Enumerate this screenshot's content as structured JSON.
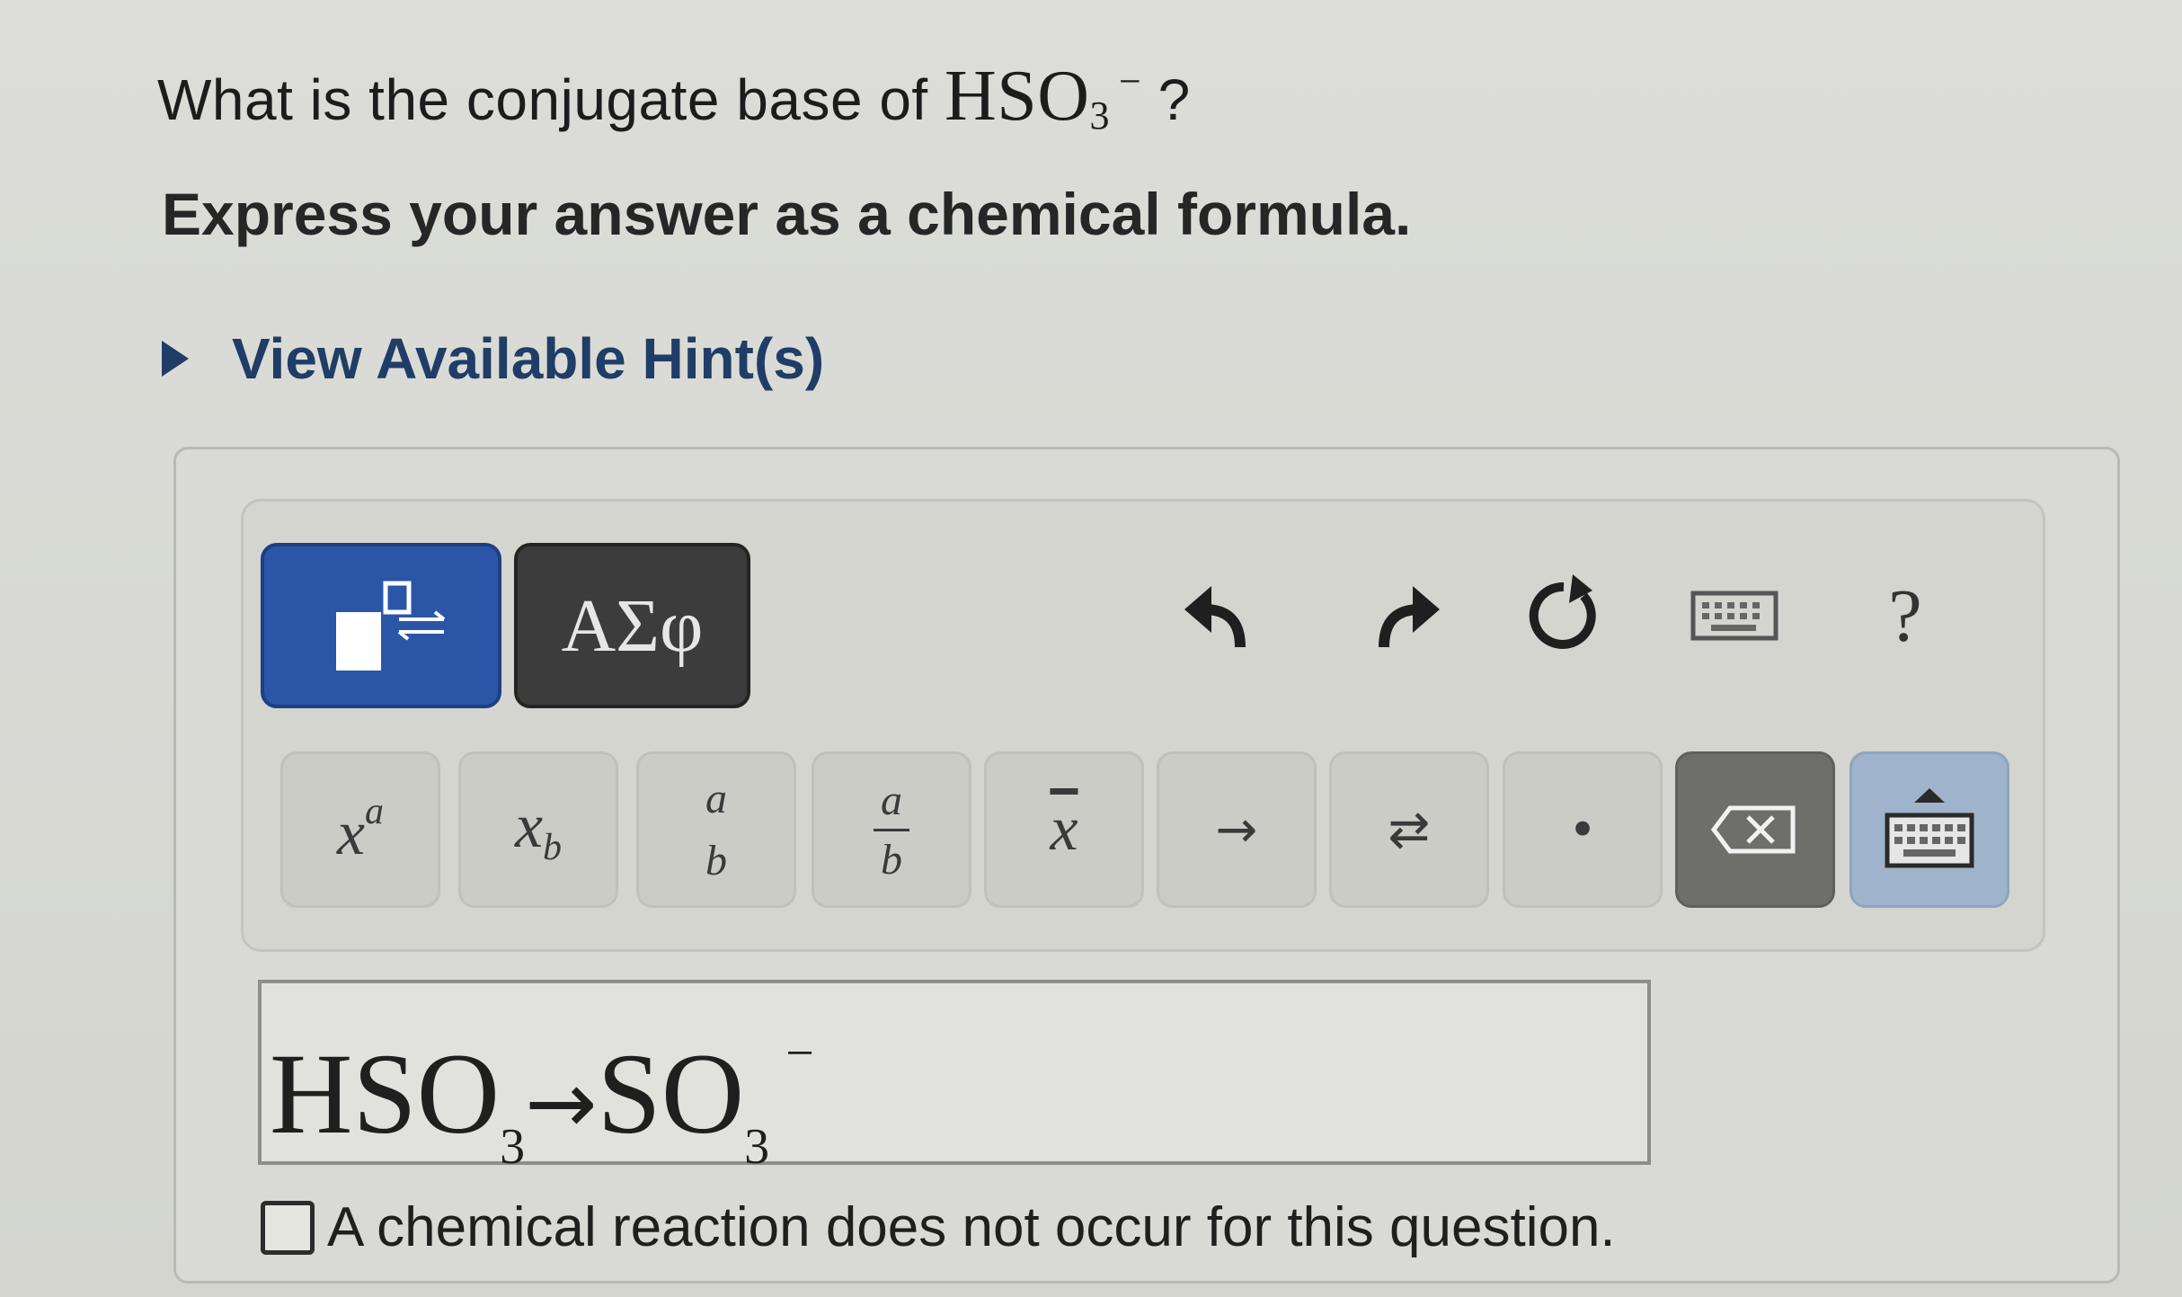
{
  "question": {
    "prefix": "What is the conjugate base of",
    "formula_main": "HSO",
    "formula_sub": "3",
    "formula_charge": "−",
    "suffix": "?"
  },
  "instruction": "Express your answer as a chemical formula.",
  "hint": {
    "label": "View Available Hint(s)",
    "icon": "triangle-right-icon"
  },
  "toolbar": {
    "modes": [
      {
        "name": "templates",
        "icon": "templates-icon",
        "active": true
      },
      {
        "name": "greek",
        "label": "ΑΣφ",
        "active": false
      }
    ],
    "tools": [
      {
        "name": "undo",
        "icon": "undo-icon"
      },
      {
        "name": "redo",
        "icon": "redo-icon"
      },
      {
        "name": "reset",
        "icon": "reset-icon"
      },
      {
        "name": "keyboard",
        "icon": "keyboard-icon"
      },
      {
        "name": "help",
        "label": "?"
      }
    ],
    "keys": [
      {
        "name": "superscript",
        "base": "x",
        "script": "a"
      },
      {
        "name": "subscript",
        "base": "x",
        "script": "b"
      },
      {
        "name": "stacked",
        "top": "a",
        "bottom": "b"
      },
      {
        "name": "fraction",
        "top": "a",
        "bottom": "b"
      },
      {
        "name": "overbar",
        "label": "x"
      },
      {
        "name": "reaction-arrow",
        "label": "→"
      },
      {
        "name": "equilibrium-arrow",
        "label": "⇄"
      },
      {
        "name": "dot",
        "label": "•"
      },
      {
        "name": "backspace",
        "icon": "backspace-icon"
      },
      {
        "name": "keyboard-toggle",
        "icon": "keyboard-icon"
      }
    ]
  },
  "answer": {
    "left_main": "HSO",
    "left_sub": "3",
    "arrow": "→",
    "right_main": "SO",
    "right_sub": "3",
    "right_charge": "−"
  },
  "no_reaction": {
    "label": "A chemical reaction does not occur for this question.",
    "checked": false
  },
  "colors": {
    "accent_blue": "#2b56a8",
    "greek_button": "#3c3c3c",
    "hint_text": "#1f3d66",
    "keyboard_key": "#9fb4cc"
  }
}
